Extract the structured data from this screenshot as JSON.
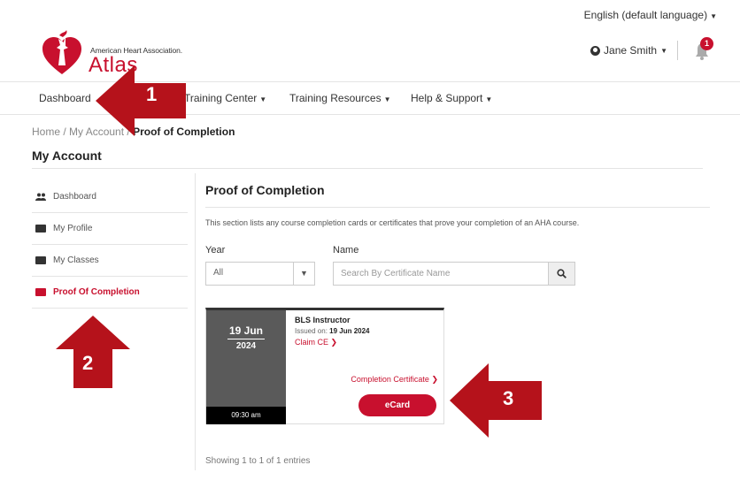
{
  "header": {
    "language": "English (default language)",
    "org_name": "American Heart Association.",
    "app_name": "Atlas",
    "user_name": "Jane Smith",
    "notification_count": "1"
  },
  "nav": {
    "items": [
      "Dashboard",
      "Training Center",
      "Training Resources",
      "Help & Support"
    ]
  },
  "breadcrumb": {
    "home": "Home",
    "sep1": " / ",
    "account": "My Account",
    "sep2": " / ",
    "current": "Proof of Completion"
  },
  "page_title": "My Account",
  "sidebar": {
    "items": [
      {
        "label": "Dashboard",
        "icon": "people-icon"
      },
      {
        "label": "My Profile",
        "icon": "id-card-icon"
      },
      {
        "label": "My Classes",
        "icon": "id-card-icon"
      },
      {
        "label": "Proof Of Completion",
        "icon": "id-card-icon",
        "active": true
      }
    ]
  },
  "main": {
    "title": "Proof of Completion",
    "description": "This section lists any course completion cards or certificates that prove your completion of an AHA course.",
    "year_label": "Year",
    "year_value": "All",
    "name_label": "Name",
    "search_placeholder": "Search By Certificate Name",
    "card": {
      "day_month": "19 Jun",
      "year": "2024",
      "time": "09:30 am",
      "title": "BLS Instructor",
      "issued_label": "Issued on: ",
      "issued_date": "19 Jun 2024",
      "claim": "Claim CE",
      "certificate": "Completion Certificate",
      "ecard": "eCard"
    },
    "showing": "Showing 1 to 1 of 1 entries"
  },
  "annotations": [
    "1",
    "2",
    "3"
  ],
  "colors": {
    "brand_red": "#c8102e",
    "annotation_red": "#b5121b",
    "card_gray": "#5a5a5a"
  }
}
